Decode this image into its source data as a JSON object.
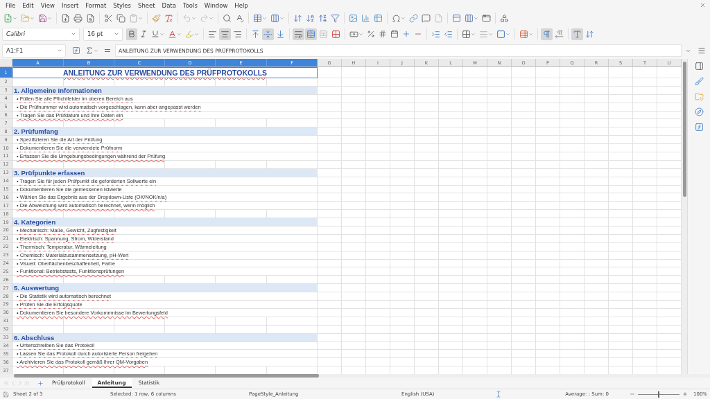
{
  "menu": [
    "File",
    "Edit",
    "View",
    "Insert",
    "Format",
    "Styles",
    "Sheet",
    "Data",
    "Tools",
    "Window",
    "Help"
  ],
  "format_toolbar": {
    "font": "Calibri",
    "size": "16 pt",
    "toggles": {
      "bold": true,
      "italic": false,
      "underline": false,
      "align_left": false,
      "align_center": true,
      "align_right": false,
      "valign_top": false,
      "valign_center": true,
      "valign_bottom": false,
      "wrap": true,
      "merge": true,
      "ltr": true,
      "rtl": false,
      "stacked": true
    }
  },
  "formula_bar": {
    "name_box": "A1:F1",
    "content": "ANLEITUNG ZUR VERWENDUNG DES PRÜFPROTOKOLLS"
  },
  "columns": [
    {
      "label": "A",
      "selected": true
    },
    {
      "label": "B",
      "selected": true
    },
    {
      "label": "C",
      "selected": true
    },
    {
      "label": "D",
      "selected": true
    },
    {
      "label": "E",
      "selected": true
    },
    {
      "label": "F",
      "selected": true
    },
    {
      "label": "G",
      "selected": false
    },
    {
      "label": "H",
      "selected": false
    },
    {
      "label": "I",
      "selected": false
    },
    {
      "label": "J",
      "selected": false
    },
    {
      "label": "K",
      "selected": false
    },
    {
      "label": "L",
      "selected": false
    },
    {
      "label": "M",
      "selected": false
    },
    {
      "label": "N",
      "selected": false
    },
    {
      "label": "O",
      "selected": false
    },
    {
      "label": "P",
      "selected": false
    },
    {
      "label": "Q",
      "selected": false
    },
    {
      "label": "R",
      "selected": false
    },
    {
      "label": "S",
      "selected": false
    },
    {
      "label": "T",
      "selected": false
    },
    {
      "label": "U",
      "selected": false
    }
  ],
  "rows": [
    {
      "number": "1",
      "kind": "title",
      "selected": true,
      "text": "ANLEITUNG ZUR VERWENDUNG DES PRÜFPROTOKOLLS"
    },
    {
      "number": "2",
      "kind": "empty",
      "selected": false
    },
    {
      "number": "3",
      "kind": "heading",
      "selected": false,
      "text": "1. Allgemeine Informationen"
    },
    {
      "number": "4",
      "kind": "bullet",
      "selected": false,
      "text": "• Füllen Sie alle Pflichtfelder im oberen Bereich aus"
    },
    {
      "number": "5",
      "kind": "bullet",
      "selected": false,
      "text": "• Die Prüfnummer wird automatisch vorgeschlagen, kann aber angepasst werden"
    },
    {
      "number": "6",
      "kind": "bullet",
      "selected": false,
      "text": "• Tragen Sie das Prüfdatum und Ihre Daten ein"
    },
    {
      "number": "7",
      "kind": "empty",
      "selected": false
    },
    {
      "number": "8",
      "kind": "heading",
      "selected": false,
      "text": "2. Prüfumfang"
    },
    {
      "number": "9",
      "kind": "bullet",
      "selected": false,
      "text": "• Spezifizieren Sie die Art der Prüfung"
    },
    {
      "number": "10",
      "kind": "bullet",
      "selected": false,
      "text": "• Dokumentieren Sie die verwendete Prüfnorm"
    },
    {
      "number": "11",
      "kind": "bullet",
      "selected": false,
      "text": "• Erfassen Sie die Umgebungsbedingungen während der Prüfung"
    },
    {
      "number": "12",
      "kind": "empty",
      "selected": false
    },
    {
      "number": "13",
      "kind": "heading",
      "selected": false,
      "text": "3. Prüfpunkte erfassen"
    },
    {
      "number": "14",
      "kind": "bullet",
      "selected": false,
      "text": "• Tragen Sie für jeden Prüfpunkt die geforderten Sollwerte ein"
    },
    {
      "number": "15",
      "kind": "bullet",
      "selected": false,
      "text": "• Dokumentieren Sie die gemessenen Istwerte"
    },
    {
      "number": "16",
      "kind": "bullet",
      "selected": false,
      "text": "• Wählen Sie das Ergebnis aus der Dropdown-Liste (OK/NOK/n/a)"
    },
    {
      "number": "17",
      "kind": "bullet",
      "selected": false,
      "text": "• Die Abweichung wird automatisch berechnet, wenn möglich"
    },
    {
      "number": "18",
      "kind": "empty",
      "selected": false
    },
    {
      "number": "19",
      "kind": "heading",
      "selected": false,
      "text": "4. Kategorien"
    },
    {
      "number": "20",
      "kind": "bullet",
      "selected": false,
      "text": "• Mechanisch: Maße, Gewicht, Zugfestigkeit"
    },
    {
      "number": "21",
      "kind": "bullet",
      "selected": false,
      "text": "• Elektrisch: Spannung, Strom, Widerstand"
    },
    {
      "number": "22",
      "kind": "bullet",
      "selected": false,
      "text": "• Thermisch: Temperatur, Wärmeleitung"
    },
    {
      "number": "23",
      "kind": "bullet",
      "selected": false,
      "text": "• Chemisch: Materialzusammensetzung, pH-Wert"
    },
    {
      "number": "24",
      "kind": "bullet",
      "selected": false,
      "text": "• Visuell: Oberflächenbeschaffenheit, Farbe"
    },
    {
      "number": "25",
      "kind": "bullet",
      "selected": false,
      "text": "• Funktional: Betriebstests, Funktionsprüfungen"
    },
    {
      "number": "26",
      "kind": "empty",
      "selected": false
    },
    {
      "number": "27",
      "kind": "heading",
      "selected": false,
      "text": "5. Auswertung"
    },
    {
      "number": "28",
      "kind": "bullet",
      "selected": false,
      "text": "• Die Statistik wird automatisch berechnet"
    },
    {
      "number": "29",
      "kind": "bullet",
      "selected": false,
      "text": "• Prüfen Sie die Erfolgsquote"
    },
    {
      "number": "30",
      "kind": "bullet",
      "selected": false,
      "text": "• Dokumentieren Sie besondere Vorkommnisse im Bewertungsfeld"
    },
    {
      "number": "31",
      "kind": "empty",
      "selected": false
    },
    {
      "number": "32",
      "kind": "empty",
      "selected": false
    },
    {
      "number": "33",
      "kind": "heading",
      "selected": false,
      "text": "6. Abschluss"
    },
    {
      "number": "34",
      "kind": "bullet",
      "selected": false,
      "text": "• Unterschreiben Sie das Protokoll"
    },
    {
      "number": "35",
      "kind": "bullet",
      "selected": false,
      "text": "• Lassen Sie das Protokoll durch autorisierte Person freigeben"
    },
    {
      "number": "36",
      "kind": "bullet",
      "selected": false,
      "text": "• Archivieren Sie das Protokoll gemäß Ihrer QM-Vorgaben"
    },
    {
      "number": "37",
      "kind": "empty",
      "selected": false
    }
  ],
  "sheet_tabs": [
    {
      "label": "Prüfprotokoll",
      "selected": false
    },
    {
      "label": "Anleitung",
      "selected": true
    },
    {
      "label": "Statistik",
      "selected": false
    }
  ],
  "status_bar": {
    "sheet": "Sheet 2 of 3",
    "selection": "Selected: 1 row, 6 columns",
    "page_style": "PageStyle_Anleitung",
    "language": "English (USA)",
    "summary": "Average: ; Sum: 0",
    "zoom": {
      "level": 0.5,
      "reading": "100%"
    }
  }
}
